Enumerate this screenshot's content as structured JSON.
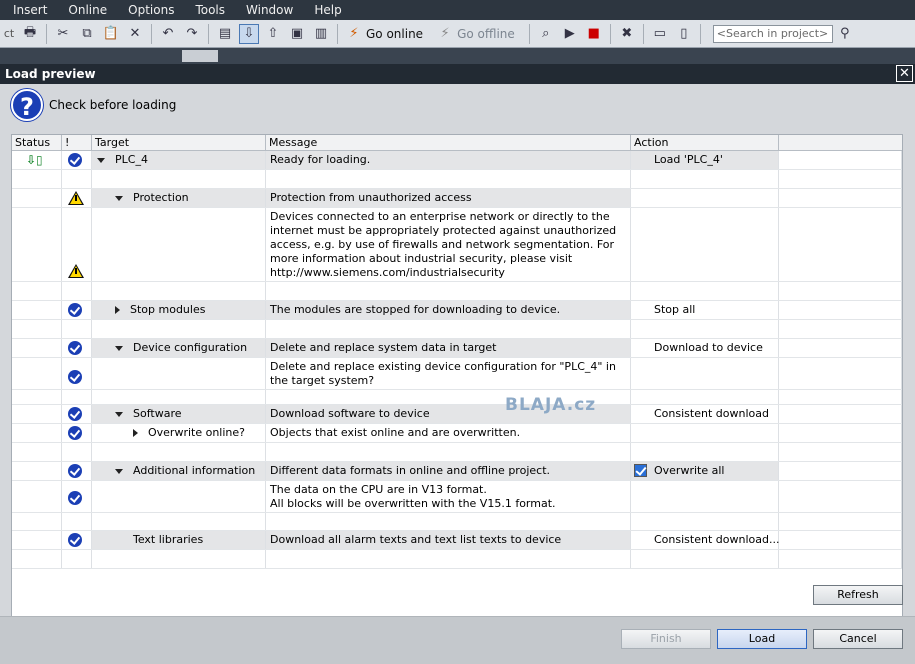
{
  "menu": [
    "Insert",
    "Online",
    "Options",
    "Tools",
    "Window",
    "Help"
  ],
  "toolbar": {
    "cut_prefix": "ct",
    "go_online": "Go online",
    "go_offline": "Go offline",
    "search_placeholder": "<Search in project>"
  },
  "dialog": {
    "title": "Load preview",
    "close_glyph": "✕",
    "heading": "Check before loading",
    "columns": [
      "Status",
      "!",
      "Target",
      "Message",
      "Action"
    ],
    "rows": [
      {
        "target": "PLC_4",
        "message": "Ready for loading.",
        "action": "Load 'PLC_4'"
      },
      {
        "target": "Protection",
        "message": "Protection from unauthorized access",
        "action": ""
      },
      {
        "target": "",
        "message": "Devices connected to an enterprise network or directly to the internet must be appropriately protected against unauthorized access, e.g. by use of firewalls and network segmentation. For more information about industrial security, please visit http://www.siemens.com/industrialsecurity",
        "action": ""
      },
      {
        "target": "Stop modules",
        "message": "The modules are stopped for downloading to device.",
        "action": "Stop all"
      },
      {
        "target": "Device configuration",
        "message": "Delete and replace system data in target",
        "action": "Download to device"
      },
      {
        "target": "",
        "message": "Delete and replace existing device configuration for \"PLC_4\" in the target system?",
        "action": ""
      },
      {
        "target": "Software",
        "message": "Download software to device",
        "action": "Consistent download"
      },
      {
        "target": "Overwrite online?",
        "message": "Objects that exist online and are overwritten.",
        "action": ""
      },
      {
        "target": "Additional information",
        "message": "Different data formats in online and offline project.",
        "action": "Overwrite all"
      },
      {
        "target": "",
        "message": "The data on the CPU are in V13 format.\nAll blocks will be overwritten with the V15.1 format.",
        "action": ""
      },
      {
        "target": "Text libraries",
        "message": "Download all alarm texts and text list texts to device",
        "action": "Consistent download..."
      }
    ],
    "watermark": "BLAJA.cz",
    "buttons": {
      "refresh": "Refresh",
      "finish": "Finish",
      "load": "Load",
      "cancel": "Cancel"
    }
  },
  "colors": {
    "accent": "#1b3fb5",
    "warning": "#ffd800",
    "checkbox": "#2a6fd6"
  }
}
